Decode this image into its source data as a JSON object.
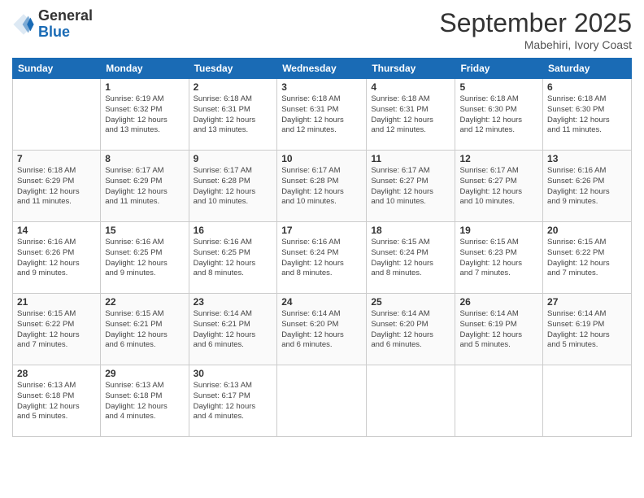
{
  "logo": {
    "general": "General",
    "blue": "Blue"
  },
  "header": {
    "month": "September 2025",
    "location": "Mabehiri, Ivory Coast"
  },
  "weekdays": [
    "Sunday",
    "Monday",
    "Tuesday",
    "Wednesday",
    "Thursday",
    "Friday",
    "Saturday"
  ],
  "weeks": [
    [
      {
        "day": "",
        "info": ""
      },
      {
        "day": "1",
        "info": "Sunrise: 6:19 AM\nSunset: 6:32 PM\nDaylight: 12 hours\nand 13 minutes."
      },
      {
        "day": "2",
        "info": "Sunrise: 6:18 AM\nSunset: 6:31 PM\nDaylight: 12 hours\nand 13 minutes."
      },
      {
        "day": "3",
        "info": "Sunrise: 6:18 AM\nSunset: 6:31 PM\nDaylight: 12 hours\nand 12 minutes."
      },
      {
        "day": "4",
        "info": "Sunrise: 6:18 AM\nSunset: 6:31 PM\nDaylight: 12 hours\nand 12 minutes."
      },
      {
        "day": "5",
        "info": "Sunrise: 6:18 AM\nSunset: 6:30 PM\nDaylight: 12 hours\nand 12 minutes."
      },
      {
        "day": "6",
        "info": "Sunrise: 6:18 AM\nSunset: 6:30 PM\nDaylight: 12 hours\nand 11 minutes."
      }
    ],
    [
      {
        "day": "7",
        "info": "Sunrise: 6:18 AM\nSunset: 6:29 PM\nDaylight: 12 hours\nand 11 minutes."
      },
      {
        "day": "8",
        "info": "Sunrise: 6:17 AM\nSunset: 6:29 PM\nDaylight: 12 hours\nand 11 minutes."
      },
      {
        "day": "9",
        "info": "Sunrise: 6:17 AM\nSunset: 6:28 PM\nDaylight: 12 hours\nand 10 minutes."
      },
      {
        "day": "10",
        "info": "Sunrise: 6:17 AM\nSunset: 6:28 PM\nDaylight: 12 hours\nand 10 minutes."
      },
      {
        "day": "11",
        "info": "Sunrise: 6:17 AM\nSunset: 6:27 PM\nDaylight: 12 hours\nand 10 minutes."
      },
      {
        "day": "12",
        "info": "Sunrise: 6:17 AM\nSunset: 6:27 PM\nDaylight: 12 hours\nand 10 minutes."
      },
      {
        "day": "13",
        "info": "Sunrise: 6:16 AM\nSunset: 6:26 PM\nDaylight: 12 hours\nand 9 minutes."
      }
    ],
    [
      {
        "day": "14",
        "info": "Sunrise: 6:16 AM\nSunset: 6:26 PM\nDaylight: 12 hours\nand 9 minutes."
      },
      {
        "day": "15",
        "info": "Sunrise: 6:16 AM\nSunset: 6:25 PM\nDaylight: 12 hours\nand 9 minutes."
      },
      {
        "day": "16",
        "info": "Sunrise: 6:16 AM\nSunset: 6:25 PM\nDaylight: 12 hours\nand 8 minutes."
      },
      {
        "day": "17",
        "info": "Sunrise: 6:16 AM\nSunset: 6:24 PM\nDaylight: 12 hours\nand 8 minutes."
      },
      {
        "day": "18",
        "info": "Sunrise: 6:15 AM\nSunset: 6:24 PM\nDaylight: 12 hours\nand 8 minutes."
      },
      {
        "day": "19",
        "info": "Sunrise: 6:15 AM\nSunset: 6:23 PM\nDaylight: 12 hours\nand 7 minutes."
      },
      {
        "day": "20",
        "info": "Sunrise: 6:15 AM\nSunset: 6:22 PM\nDaylight: 12 hours\nand 7 minutes."
      }
    ],
    [
      {
        "day": "21",
        "info": "Sunrise: 6:15 AM\nSunset: 6:22 PM\nDaylight: 12 hours\nand 7 minutes."
      },
      {
        "day": "22",
        "info": "Sunrise: 6:15 AM\nSunset: 6:21 PM\nDaylight: 12 hours\nand 6 minutes."
      },
      {
        "day": "23",
        "info": "Sunrise: 6:14 AM\nSunset: 6:21 PM\nDaylight: 12 hours\nand 6 minutes."
      },
      {
        "day": "24",
        "info": "Sunrise: 6:14 AM\nSunset: 6:20 PM\nDaylight: 12 hours\nand 6 minutes."
      },
      {
        "day": "25",
        "info": "Sunrise: 6:14 AM\nSunset: 6:20 PM\nDaylight: 12 hours\nand 6 minutes."
      },
      {
        "day": "26",
        "info": "Sunrise: 6:14 AM\nSunset: 6:19 PM\nDaylight: 12 hours\nand 5 minutes."
      },
      {
        "day": "27",
        "info": "Sunrise: 6:14 AM\nSunset: 6:19 PM\nDaylight: 12 hours\nand 5 minutes."
      }
    ],
    [
      {
        "day": "28",
        "info": "Sunrise: 6:13 AM\nSunset: 6:18 PM\nDaylight: 12 hours\nand 5 minutes."
      },
      {
        "day": "29",
        "info": "Sunrise: 6:13 AM\nSunset: 6:18 PM\nDaylight: 12 hours\nand 4 minutes."
      },
      {
        "day": "30",
        "info": "Sunrise: 6:13 AM\nSunset: 6:17 PM\nDaylight: 12 hours\nand 4 minutes."
      },
      {
        "day": "",
        "info": ""
      },
      {
        "day": "",
        "info": ""
      },
      {
        "day": "",
        "info": ""
      },
      {
        "day": "",
        "info": ""
      }
    ]
  ]
}
